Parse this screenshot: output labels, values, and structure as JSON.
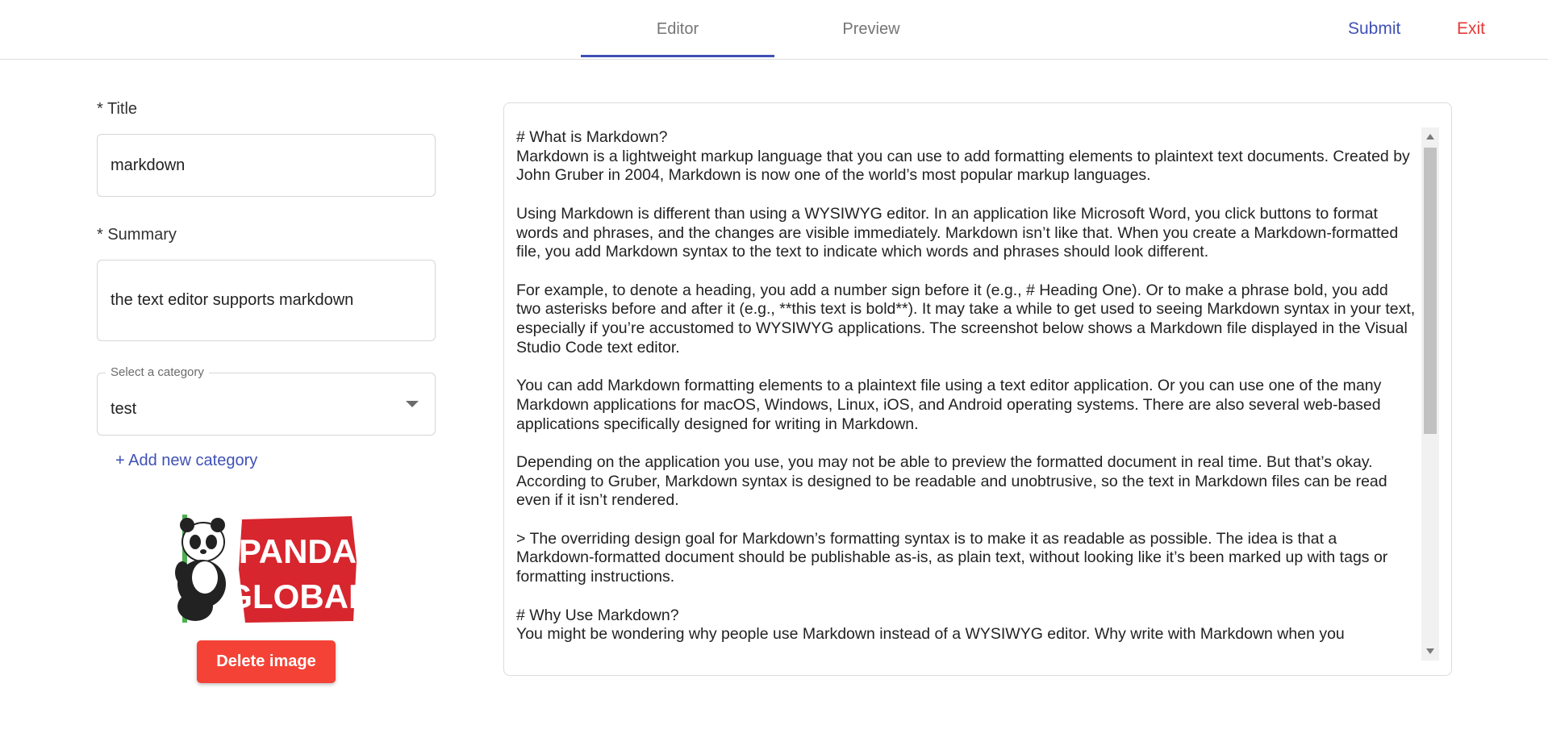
{
  "tabs": [
    {
      "label": "Editor",
      "active": true
    },
    {
      "label": "Preview",
      "active": false
    }
  ],
  "header": {
    "submit_label": "Submit",
    "exit_label": "Exit"
  },
  "form": {
    "title_label": "* Title",
    "title_value": "markdown",
    "summary_label": "* Summary",
    "summary_value": "the text editor supports markdown",
    "category_legend": "Select a category",
    "category_value": "test",
    "add_category_label": "+ Add new category",
    "logo_text_line1": "PANDA",
    "logo_text_line2": "GLOBAL",
    "delete_image_label": "Delete image"
  },
  "editor": {
    "content": "# What is Markdown?\nMarkdown is a lightweight markup language that you can use to add formatting elements to plaintext text documents. Created by John Gruber in 2004, Markdown is now one of the world’s most popular markup languages.\n\nUsing Markdown is different than using a WYSIWYG editor. In an application like Microsoft Word, you click buttons to format words and phrases, and the changes are visible immediately. Markdown isn’t like that. When you create a Markdown-formatted file, you add Markdown syntax to the text to indicate which words and phrases should look different.\n\nFor example, to denote a heading, you add a number sign before it (e.g., # Heading One). Or to make a phrase bold, you add two asterisks before and after it (e.g., **this text is bold**). It may take a while to get used to seeing Markdown syntax in your text, especially if you’re accustomed to WYSIWYG applications. The screenshot below shows a Markdown file displayed in the Visual Studio Code text editor.\n\nYou can add Markdown formatting elements to a plaintext file using a text editor application. Or you can use one of the many Markdown applications for macOS, Windows, Linux, iOS, and Android operating systems. There are also several web-based applications specifically designed for writing in Markdown.\n\nDepending on the application you use, you may not be able to preview the formatted document in real time. But that’s okay. According to Gruber, Markdown syntax is designed to be readable and unobtrusive, so the text in Markdown files can be read even if it isn’t rendered.\n\n> The overriding design goal for Markdown’s formatting syntax is to make it as readable as possible. The idea is that a Markdown-formatted document should be publishable as-is, as plain text, without looking like it’s been marked up with tags or formatting instructions.\n\n# Why Use Markdown?\nYou might be wondering why people use Markdown instead of a WYSIWYG editor. Why write with Markdown when you"
  },
  "colors": {
    "accent": "#3f51b5",
    "danger": "#f44336",
    "exit": "#e53935",
    "logo_red": "#d7262e",
    "bamboo": "#4caf50"
  }
}
